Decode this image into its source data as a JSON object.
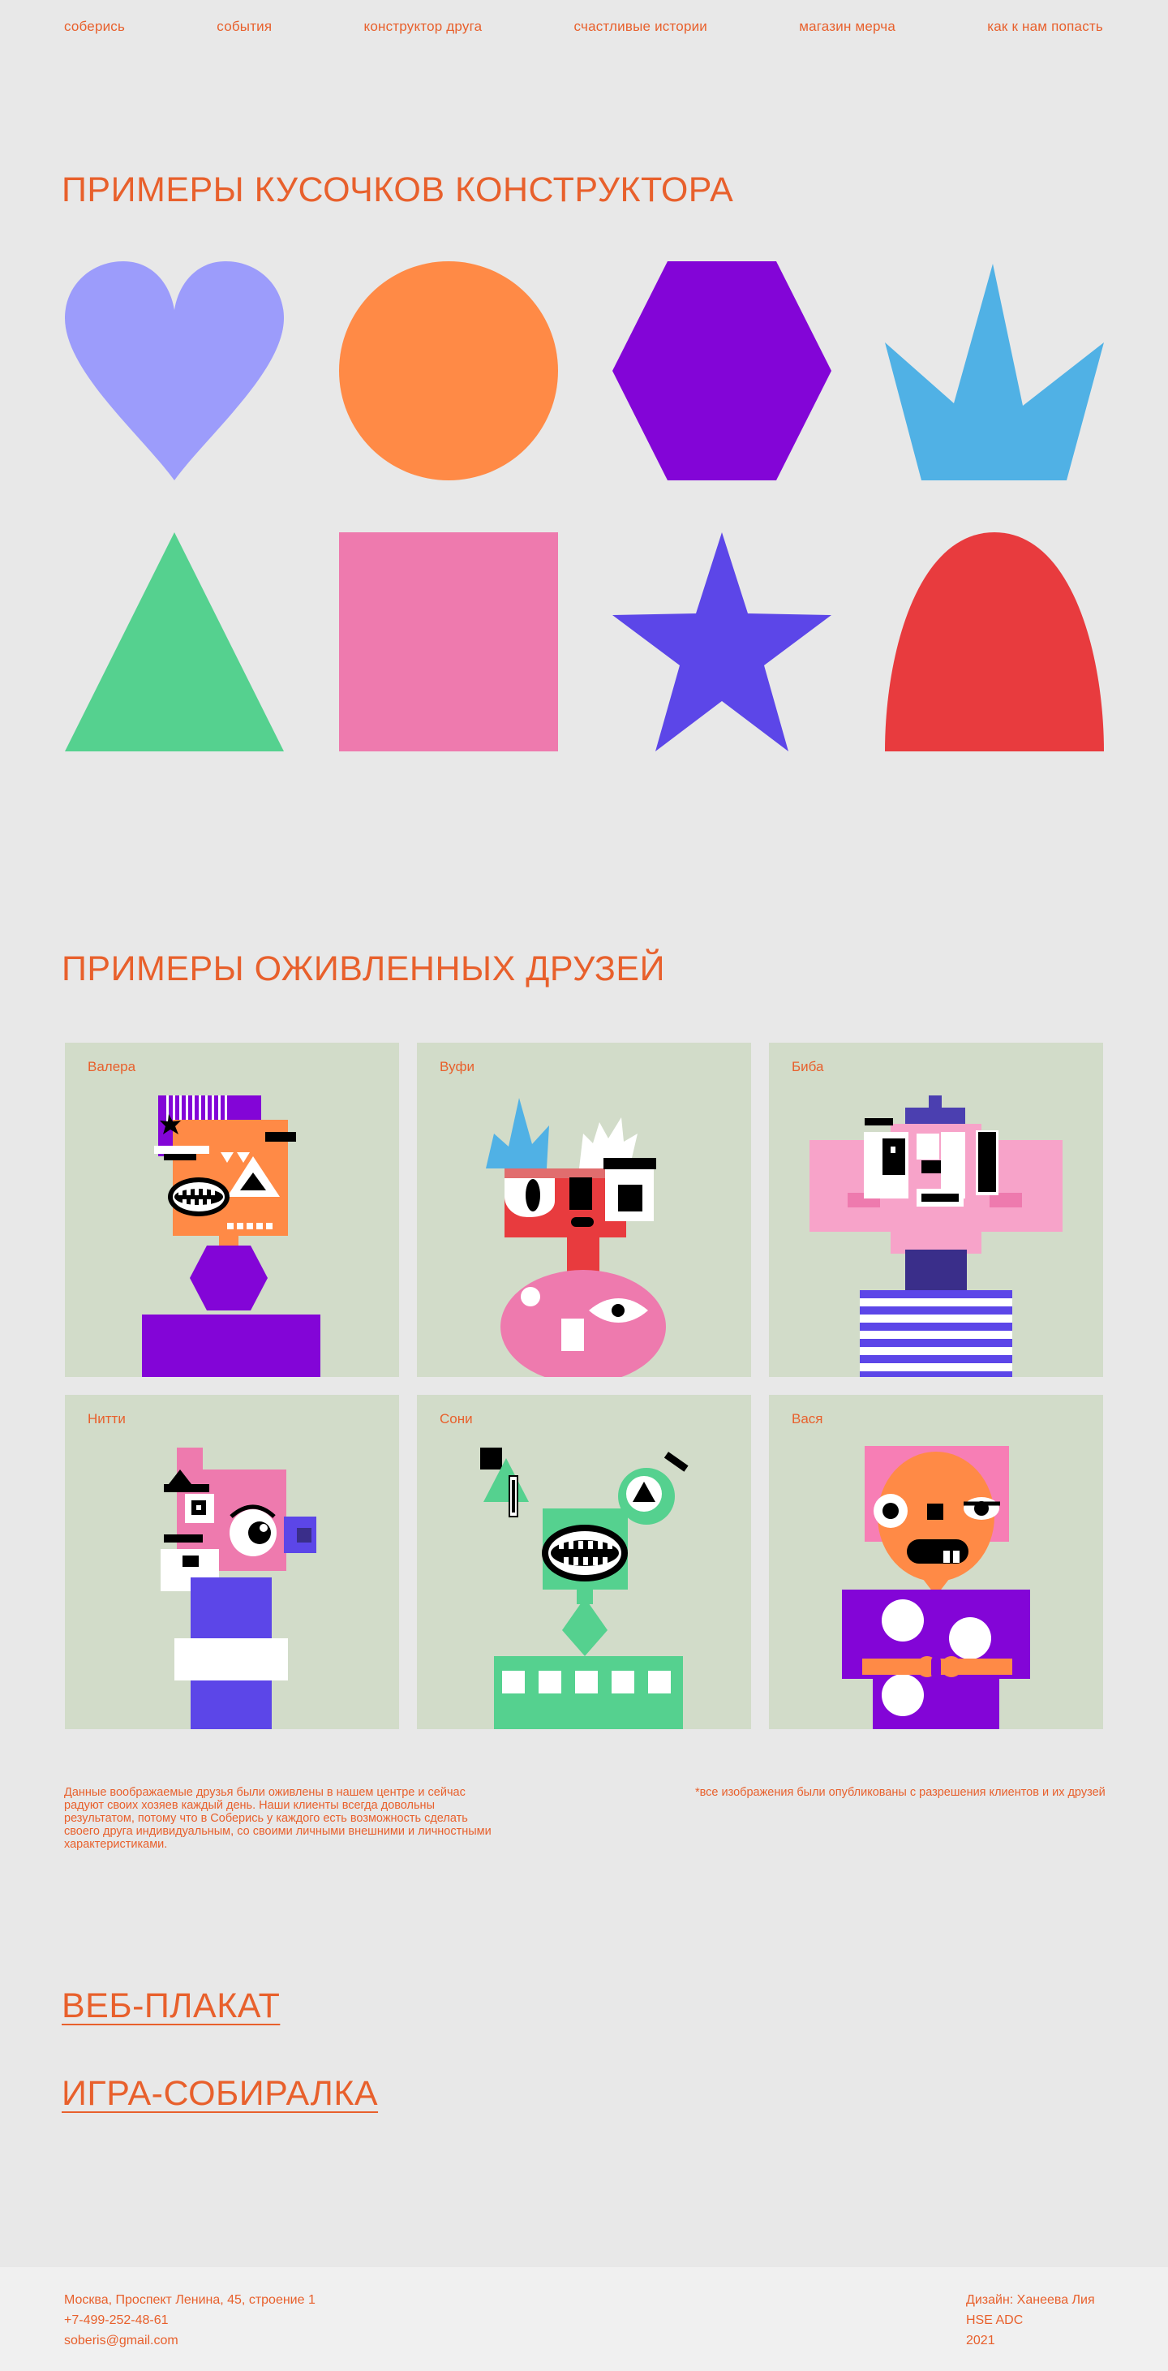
{
  "nav": {
    "items": [
      {
        "label": "соберись"
      },
      {
        "label": "события"
      },
      {
        "label": "конструктор друга"
      },
      {
        "label": "счастливые истории"
      },
      {
        "label": "магазин мерча"
      },
      {
        "label": "как к нам попасть"
      }
    ]
  },
  "pieces": {
    "title": "ПРИМЕРЫ КУСОЧКОВ КОНСТРУКТОРА",
    "shapes": [
      {
        "shape": "heart",
        "color": "#9c9cfb"
      },
      {
        "shape": "circle",
        "color": "#ff8a46"
      },
      {
        "shape": "hexagon",
        "color": "#8305d7"
      },
      {
        "shape": "crown",
        "color": "#50b1e5"
      },
      {
        "shape": "triangle",
        "color": "#55d18f"
      },
      {
        "shape": "square",
        "color": "#ee7aae"
      },
      {
        "shape": "star",
        "color": "#5c46e8"
      },
      {
        "shape": "arch",
        "color": "#e83b3e"
      }
    ]
  },
  "friends": {
    "title": "ПРИМЕРЫ ОЖИВЛЕННЫХ ДРУЗЕЙ",
    "cards": [
      {
        "name": "Валера"
      },
      {
        "name": "Вуфи"
      },
      {
        "name": "Биба"
      },
      {
        "name": "Нитти"
      },
      {
        "name": "Сони"
      },
      {
        "name": "Вася"
      }
    ]
  },
  "notes": {
    "left": "Данные воображаемые друзья были оживлены в нашем центре и сейчас радуют своих хозяев каждый день. Наши клиенты всегда довольны результатом, потому что в Соберись у каждого есть возможность сделать своего друга индивидуальным, со своими личными внешними и личностными характеристиками.",
    "right": "*все изображения были опубликованы с разрешения клиентов и их друзей"
  },
  "links": {
    "poster": "ВЕБ-ПЛАКАТ",
    "game": "ИГРА-СОБИРАЛКА"
  },
  "footer": {
    "address": "Москва, Проспект Ленина, 45, строение 1",
    "phone": "+7-499-252-48-61",
    "email": "soberis@gmail.com",
    "design": "Дизайн: Ханеева Лия",
    "school": "HSE ADC",
    "year": "2021"
  },
  "colors": {
    "accent": "#e8602c",
    "background": "#e8e8e8",
    "card_bg": "#d2dcc9",
    "footer_bg": "#f0f0f0"
  }
}
